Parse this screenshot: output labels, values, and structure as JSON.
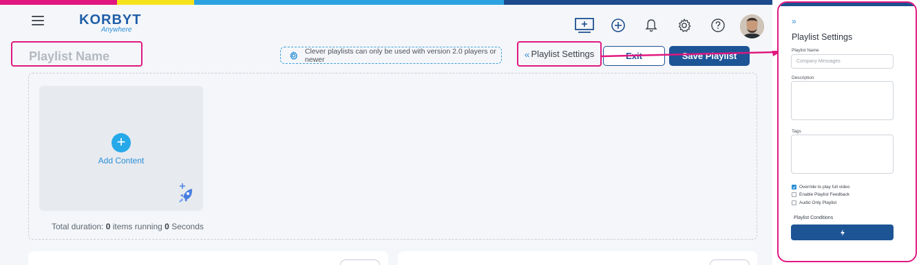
{
  "brand": {
    "logo_text": "KORBYT",
    "logo_sub": "Anywhere",
    "bar_colors": [
      "#e0177f",
      "#f6e21b",
      "#2ba3e0",
      "#1c4a8c"
    ]
  },
  "header": {
    "icons": [
      "monitor-add-icon",
      "plus-circle-icon",
      "bell-icon",
      "gear-icon",
      "help-icon"
    ]
  },
  "toolbar": {
    "playlist_name_placeholder": "Playlist Name",
    "notice_text": "Clever playlists can only be used with version 2.0 players or newer",
    "playlist_settings_label": "Playlist Settings",
    "exit_label": "Exit",
    "save_label": "Save Playlist"
  },
  "content": {
    "add_content_label": "Add Content",
    "total_prefix": "Total duration:",
    "items_count": "0",
    "items_text": "items running",
    "seconds_count": "0",
    "seconds_text": "Seconds"
  },
  "side_panel": {
    "title": "Playlist Settings",
    "name_label": "Playlist Name",
    "name_placeholder": "Company Messages",
    "description_label": "Description",
    "tags_label": "Tags",
    "checkboxes": [
      {
        "label": "Override to play full video",
        "checked": true
      },
      {
        "label": "Enable Playlist Feedback",
        "checked": false
      },
      {
        "label": "Audio Only Playlist",
        "checked": false
      }
    ],
    "conditions_label": "Playlist Conditions"
  },
  "colors": {
    "highlight": "#e0177f",
    "primary": "#1d5496",
    "accent": "#26a9e8"
  }
}
